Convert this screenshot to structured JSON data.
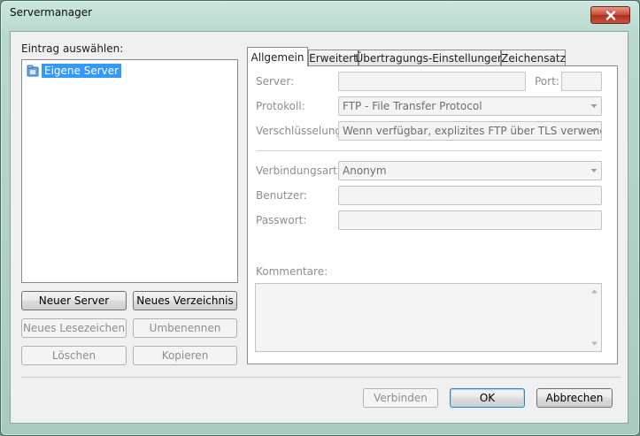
{
  "window": {
    "title": "Servermanager"
  },
  "left": {
    "label": "Eintrag auswählen:",
    "tree": [
      {
        "label": "Eigene Server",
        "icon": "server-folder-icon",
        "selected": true
      }
    ],
    "buttons": {
      "new_server": "Neuer Server",
      "new_folder": "Neues Verzeichnis",
      "new_bookmark": "Neues Lesezeichen",
      "rename": "Umbenennen",
      "delete": "Löschen",
      "copy": "Kopieren"
    }
  },
  "tabs": [
    "Allgemein",
    "Erweitert",
    "Übertragungs-Einstellungen",
    "Zeichensatz"
  ],
  "general": {
    "server_label": "Server:",
    "server_value": "",
    "port_label": "Port:",
    "port_value": "",
    "protocol_label": "Protokoll:",
    "protocol_value": "FTP - File Transfer Protocol",
    "encryption_label": "Verschlüsselung:",
    "encryption_value": "Wenn verfügbar, explizites FTP über TLS verwenden",
    "logon_label": "Verbindungsart:",
    "logon_value": "Anonym",
    "user_label": "Benutzer:",
    "user_value": "",
    "password_label": "Passwort:",
    "password_value": "",
    "comments_label": "Kommentare:",
    "comments_value": ""
  },
  "footer": {
    "connect": "Verbinden",
    "ok": "OK",
    "cancel": "Abbrechen"
  },
  "colors": {
    "selection": "#3399ff",
    "disabled_text": "#8d8d8d",
    "close_button": "#c8483a"
  }
}
